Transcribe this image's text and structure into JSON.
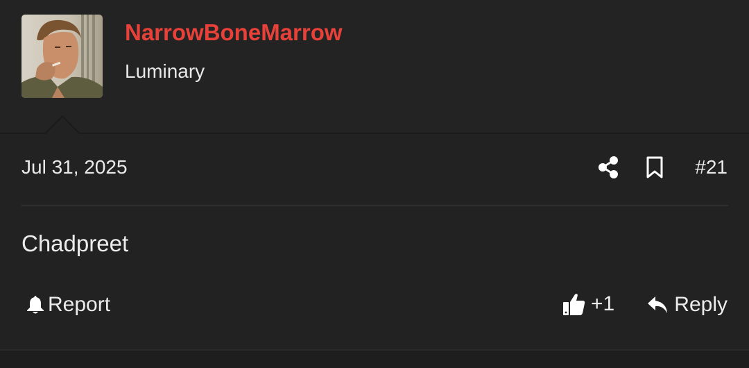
{
  "user": {
    "username": "NarrowBoneMarrow",
    "title": "Luminary",
    "username_color": "#e8413a"
  },
  "post": {
    "date": "Jul 31, 2025",
    "number": "#21",
    "body": "Chadpreet"
  },
  "actions": {
    "report_label": "Report",
    "like_count": "+1",
    "reply_label": "Reply"
  },
  "icons": {
    "avatar": "user-avatar-photo",
    "share": "share-icon",
    "bookmark": "bookmark-icon",
    "report": "bell-icon",
    "like": "thumbs-up-icon",
    "reply": "reply-arrow-icon"
  }
}
